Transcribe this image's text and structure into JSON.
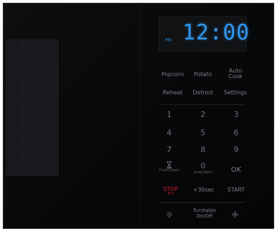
{
  "display": {
    "am_pm": "PM",
    "time": "12:00",
    "color": "#2f97ee"
  },
  "function_keys": {
    "popcorn": "Popcorn",
    "potato": "Potato",
    "auto_cook": "Auto\nCook",
    "reheat": "Reheat",
    "defrost": "Defrost",
    "settings": "Settings"
  },
  "keypad": {
    "k1": "1",
    "k2": "2",
    "k3": "3",
    "k4": "4",
    "k5": "5",
    "k6": "6",
    "k7": "7",
    "k8": "8",
    "k9": "9",
    "k0": "0",
    "clock_sub": "Clock(3sec)",
    "lock_sub": "Lock(3sec)",
    "ok": "OK"
  },
  "controls": {
    "stop": "STOP",
    "eco": "Eco",
    "plus30": "+30sec",
    "start": "START",
    "turntable": "Turntable\nOn/Off"
  },
  "icons": {
    "clock": "hourglass-icon",
    "light": "light-bulb-icon",
    "fan": "fan-icon"
  },
  "colors": {
    "stop": "#d2212b",
    "label": "#7c7f85"
  }
}
